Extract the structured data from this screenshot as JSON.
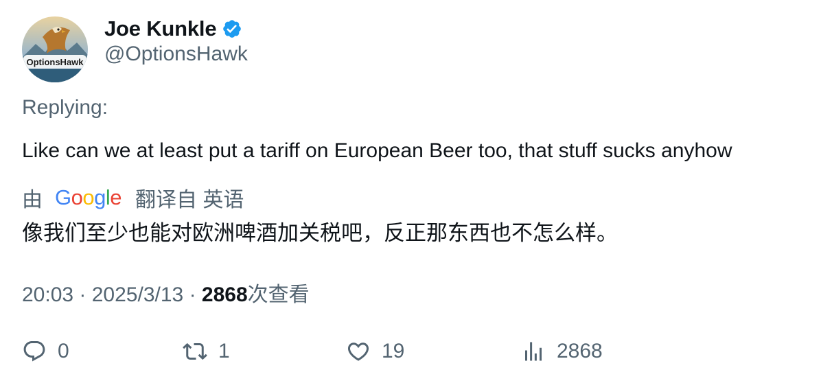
{
  "tweet": {
    "author": {
      "display_name": "Joe Kunkle",
      "handle": "@OptionsHawk",
      "verified": true,
      "avatar_text": "OptionsHawk",
      "verified_color": "#1d9bf0"
    },
    "replying_label": "Replying:",
    "text": "Like can we at least put a tariff on European Beer too, that stuff sucks anyhow",
    "translation": {
      "by_label": "由",
      "provider": "Google",
      "translated_from_label": "翻译自 英语",
      "text": "像我们至少也能对欧洲啤酒加关税吧，反正那东西也不怎么样。"
    },
    "time": "20:03",
    "separator": "·",
    "date": "2025/3/13",
    "views_count": "2868",
    "views_label": "次查看"
  },
  "actions": {
    "reply": {
      "icon": "reply-icon",
      "count": "0"
    },
    "retweet": {
      "icon": "retweet-icon",
      "count": "1"
    },
    "like": {
      "icon": "heart-icon",
      "count": "19"
    },
    "views": {
      "icon": "analytics-icon",
      "count": "2868"
    }
  },
  "colors": {
    "primary_text": "#0f1419",
    "secondary_text": "#536471",
    "google_blue": "#4285F4",
    "google_red": "#EA4335",
    "google_yellow": "#FBBC05",
    "google_green": "#34A853"
  }
}
